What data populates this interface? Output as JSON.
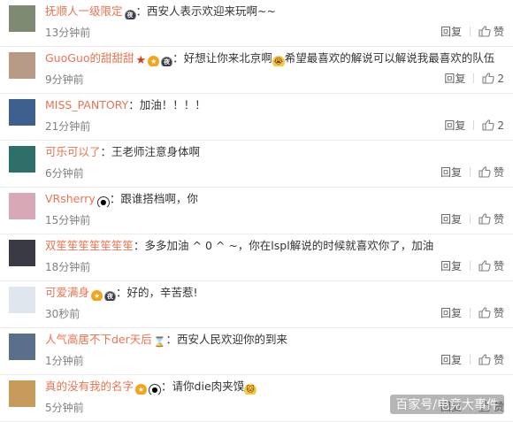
{
  "comments": [
    {
      "username": "抚顺人一级限定",
      "badges": [
        "night"
      ],
      "text": "西安人表示欢迎来玩啊~~",
      "time": "13分钟前",
      "reply": "回复",
      "likes": "赞",
      "avatar_color": "#7f8a72"
    },
    {
      "username": "GuoGuo的甜甜甜",
      "badges": [
        "star",
        "vip",
        "night"
      ],
      "text": "好想让你来北京啊",
      "emoji": "😭",
      "text2": "希望最喜欢的解说可以解说我最喜欢的队伍",
      "time": "9分钟前",
      "reply": "回复",
      "likes": "2",
      "avatar_color": "#b79a86"
    },
    {
      "username": "MISS_PANTORY",
      "badges": [],
      "text": "加油！！！！",
      "time": "21分钟前",
      "reply": "回复",
      "likes": "2",
      "avatar_color": "#3f5f8f"
    },
    {
      "username": "可乐可以了",
      "badges": [],
      "text": "王老师注意身体啊",
      "time": "6分钟前",
      "reply": "回复",
      "likes": "赞",
      "avatar_color": "#2f6f6a"
    },
    {
      "username": "VRsherry",
      "badges": [
        "panda"
      ],
      "text": "跟谁搭档啊，你",
      "time": "15分钟前",
      "reply": "回复",
      "likes": "赞",
      "avatar_color": "#d7a9b6"
    },
    {
      "username": "双笙笙笙笙笙笙笙",
      "badges": [],
      "text": "多多加油 ^ 0 ^ ~，你在lspl解说的时候就喜欢你了，加油",
      "time": "18分钟前",
      "reply": "回复",
      "likes": "赞",
      "avatar_color": "#3a3a44"
    },
    {
      "username": "可爱满身",
      "badges": [
        "vip",
        "night"
      ],
      "text": "好的，辛苦惹!",
      "time": "30秒前",
      "reply": "回复",
      "likes": "赞",
      "avatar_color": "#dfe6ee"
    },
    {
      "username": "人气高居不下der天后",
      "badges": [
        "hourglass"
      ],
      "text": "西安人民欢迎你的到来",
      "time": "1分钟前",
      "reply": "回复",
      "likes": "赞",
      "avatar_color": "#5a6f8a"
    },
    {
      "username": "真的没有我的名字",
      "badges": [
        "vip",
        "panda"
      ],
      "text": "请你die肉夹馍",
      "emoji": "🐱",
      "time": "5分钟前",
      "reply": "回复",
      "likes": "赞",
      "avatar_color": "#c69a5a"
    }
  ],
  "watermark": "百家号/电竞大事件",
  "colors": {
    "username": "#eb7350",
    "text": "#333333",
    "meta": "#808080"
  }
}
